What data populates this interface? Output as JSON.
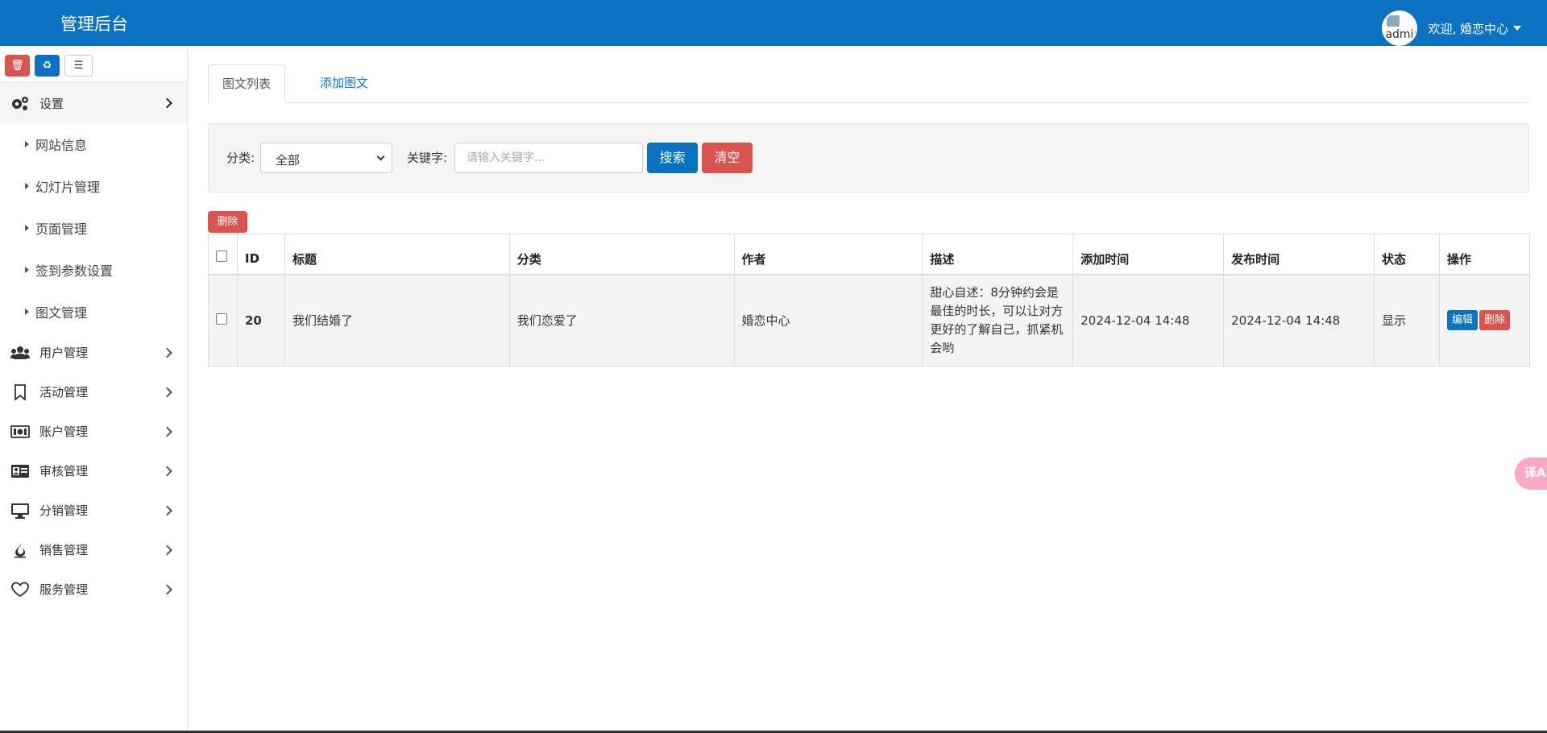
{
  "header": {
    "brand": "管理后台",
    "avatar_alt": "admin",
    "welcome": "欢迎, 婚恋中心"
  },
  "colors": {
    "primary": "#0b72c2",
    "danger": "#d9534f"
  },
  "sidebar": {
    "tools": [
      {
        "icon": "trash-icon",
        "glyph": "🗑"
      },
      {
        "icon": "recycle-icon",
        "glyph": "♻"
      },
      {
        "icon": "list-icon",
        "glyph": "☰"
      }
    ],
    "menu": [
      {
        "label": "设置",
        "icon": "gears-icon",
        "expanded": true
      },
      {
        "label": "用户管理",
        "icon": "users-icon"
      },
      {
        "label": "活动管理",
        "icon": "bookmark-icon"
      },
      {
        "label": "账户管理",
        "icon": "money-icon"
      },
      {
        "label": "审核管理",
        "icon": "id-card-icon"
      },
      {
        "label": "分销管理",
        "icon": "desktop-icon"
      },
      {
        "label": "销售管理",
        "icon": "fire-icon"
      },
      {
        "label": "服务管理",
        "icon": "heart-icon"
      }
    ],
    "submenu": [
      "网站信息",
      "幻灯片管理",
      "页面管理",
      "签到参数设置",
      "图文管理"
    ]
  },
  "tabs": {
    "active": "图文列表",
    "add": "添加图文"
  },
  "filter": {
    "category_label": "分类:",
    "category_value": "全部",
    "keyword_label": "关键字:",
    "keyword_placeholder": "请输入关键字...",
    "search_button": "搜索",
    "clear_button": "清空"
  },
  "bulk_delete": "删除",
  "table": {
    "columns": [
      "ID",
      "标题",
      "分类",
      "作者",
      "描述",
      "添加时间",
      "发布时间",
      "状态",
      "操作"
    ],
    "rows": [
      {
        "id": "20",
        "title": "我们结婚了",
        "category": "我们恋爱了",
        "author": "婚恋中心",
        "description": "甜心自述：8分钟约会是最佳的时长，可以让对方更好的了解自己，抓紧机会哟",
        "added": "2024-12-04 14:48",
        "published": "2024-12-04 14:48",
        "status": "显示",
        "edit": "编辑",
        "delete": "删除"
      }
    ]
  },
  "fab": {
    "glyph": "译A"
  }
}
